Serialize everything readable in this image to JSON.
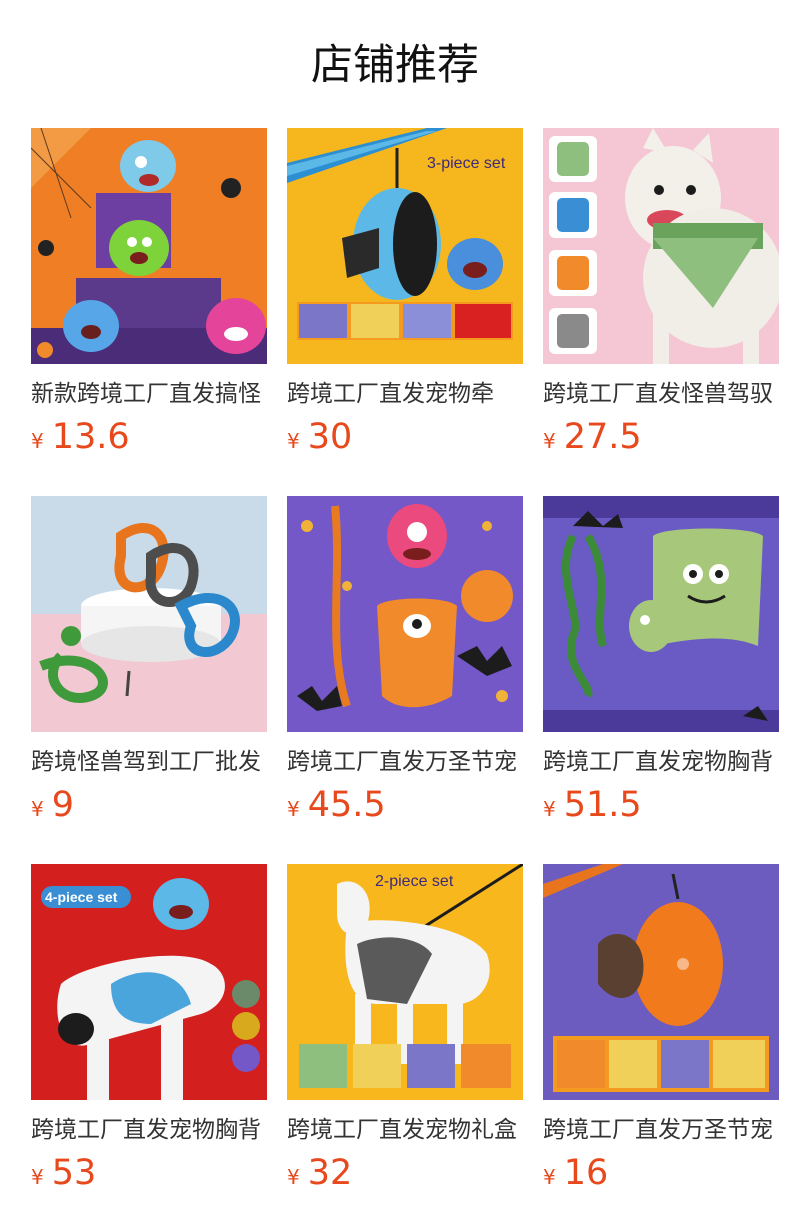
{
  "page": {
    "title": "店铺推荐"
  },
  "currency": "¥",
  "products": [
    {
      "name": "新款跨境工厂直发搞怪",
      "price": "13.6",
      "image": "halloween-monster-plush-toys",
      "colors": [
        "#ef7e24",
        "#5b3a8c",
        "#7fd33a",
        "#e4449a",
        "#57a6e8"
      ]
    },
    {
      "name": "跨境工厂直发宠物牵",
      "price": "30",
      "image": "poop-bag-holder-set",
      "overlay_text": "3-piece set",
      "colors": [
        "#f6b71e",
        "#2b8fd1",
        "#5cb8e6"
      ]
    },
    {
      "name": "跨境工厂直发怪兽驾驭",
      "price": "27.5",
      "image": "bulldog-wearing-green-harness",
      "colors": [
        "#f5c6d4",
        "#6aa45c",
        "#ffffff"
      ]
    },
    {
      "name": "跨境怪兽驾到工厂批发",
      "price": "9",
      "image": "dog-leashes-display",
      "colors": [
        "#c9dbe8",
        "#f2c9d2",
        "#e8751d",
        "#2c88cc",
        "#3f9a3c"
      ]
    },
    {
      "name": "跨境工厂直发万圣节宠",
      "price": "45.5",
      "image": "orange-harness-with-monster-toy",
      "colors": [
        "#7458c7",
        "#f18a2a",
        "#ea4a7d"
      ]
    },
    {
      "name": "跨境工厂直发宠物胸背",
      "price": "51.5",
      "image": "green-harness-leash-set",
      "colors": [
        "#6a5ac4",
        "#a7c77b",
        "#3b8b38"
      ]
    },
    {
      "name": "跨境工厂直发宠物胸背",
      "price": "53",
      "image": "blue-harness-on-mannequin",
      "overlay_text": "4-piece set",
      "colors": [
        "#d41f1f",
        "#4aa5dd",
        "#ffffff"
      ]
    },
    {
      "name": "跨境工厂直发宠物礼盒",
      "price": "32",
      "image": "gray-harness-on-mannequin",
      "overlay_text": "2-piece set",
      "colors": [
        "#f8b71d",
        "#5a5a5a",
        "#ffffff"
      ]
    },
    {
      "name": "跨境工厂直发万圣节宠",
      "price": "16",
      "image": "orange-poop-bag-dispenser",
      "colors": [
        "#6d5cc0",
        "#f07a1c",
        "#5a4030"
      ]
    }
  ]
}
